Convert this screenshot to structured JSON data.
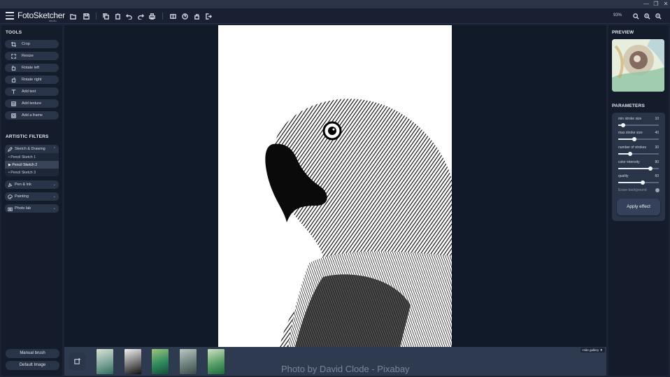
{
  "window": {
    "controls": {
      "minimize": "—",
      "restore": "❐",
      "close": "✕"
    }
  },
  "app": {
    "name": "FotoSketcher",
    "subtitle": "studio"
  },
  "toolbar": {
    "icons": [
      "open-folder-icon",
      "save-icon",
      "copy-icon",
      "paste-icon",
      "undo-icon",
      "redo-icon",
      "print-icon",
      "compare-icon",
      "help-icon",
      "share-icon",
      "exit-icon"
    ],
    "zoom_level": "93%"
  },
  "tools": {
    "title": "TOOLS",
    "items": [
      {
        "label": "Crop",
        "icon": "crop-icon"
      },
      {
        "label": "Resize",
        "icon": "resize-icon"
      },
      {
        "label": "Rotate left",
        "icon": "rotate-left-icon"
      },
      {
        "label": "Rotate right",
        "icon": "rotate-right-icon"
      },
      {
        "label": "Add text",
        "icon": "text-icon"
      },
      {
        "label": "Add texture",
        "icon": "texture-icon"
      },
      {
        "label": "Add a frame",
        "icon": "frame-icon"
      }
    ]
  },
  "filters": {
    "title": "ARTISTIC FILTERS",
    "groups": [
      {
        "label": "Sketch & Drawing",
        "icon": "pencil-icon",
        "expanded": true,
        "items": [
          "• Pencil Sketch 1",
          "▶ Pencil Sketch 2",
          "• Pencil Sketch 3"
        ],
        "active": 1
      },
      {
        "label": "Pen & Ink",
        "icon": "pen-icon"
      },
      {
        "label": "Painting",
        "icon": "palette-icon"
      },
      {
        "label": "Photo lab",
        "icon": "camera-icon"
      }
    ]
  },
  "bottom_buttons": {
    "manual_brush": "Manual brush",
    "default_image": "Default Image"
  },
  "gallery": {
    "hide_label": "Hide gallery ▼",
    "credit": "Photo by David Clode - Pixabay",
    "thumbnails": [
      "colored-parrot",
      "sketch-parrot",
      "green-parrot",
      "grey-parrot",
      "colored-parrot-2"
    ]
  },
  "preview": {
    "title": "PREVIEW"
  },
  "parameters": {
    "title": "PARAMETERS",
    "sliders": [
      {
        "label": "min stroke size",
        "value": "10",
        "fraction": 0.12
      },
      {
        "label": "max stroke size",
        "value": "40",
        "fraction": 0.4
      },
      {
        "label": "number of strokes",
        "value": "30",
        "fraction": 0.3
      },
      {
        "label": "color intensity",
        "value": "80",
        "fraction": 0.8
      },
      {
        "label": "quality",
        "value": "60",
        "fraction": 0.6
      }
    ],
    "erase_background": "Erase background",
    "apply_button": "Apply effect"
  },
  "colors": {
    "panel": "#141c2b",
    "canvas": "#111a29",
    "button": "#2a3448",
    "accent": "#e6ebf3"
  }
}
